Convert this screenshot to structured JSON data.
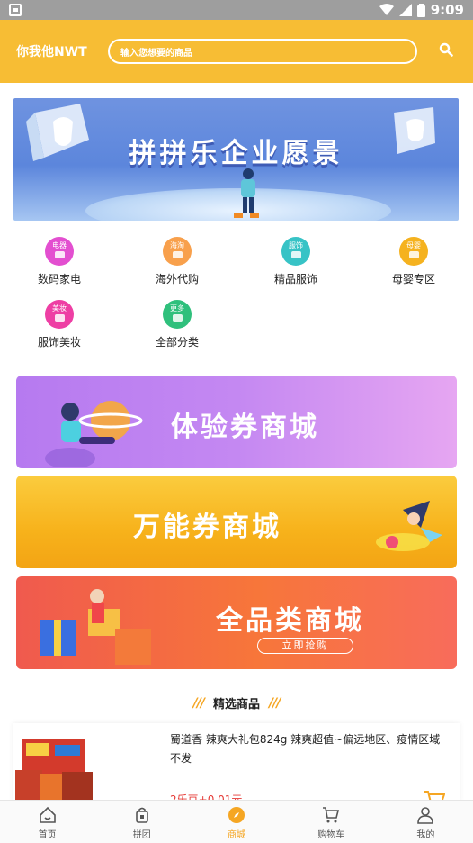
{
  "status_bar": {
    "time": "9:09"
  },
  "header": {
    "brand": "你我他NWT",
    "search_placeholder": "输入您想要的商品"
  },
  "banner": {
    "title": "拼拼乐企业愿景"
  },
  "categories": [
    {
      "icon_text": "电器",
      "label": "数码家电",
      "color": "#e34fd0"
    },
    {
      "icon_text": "海淘",
      "label": "海外代购",
      "color": "#f8a04c"
    },
    {
      "icon_text": "服饰",
      "label": "精品服饰",
      "color": "#37c3c6"
    },
    {
      "icon_text": "母婴",
      "label": "母婴专区",
      "color": "#f5b21f"
    },
    {
      "icon_text": "美妆",
      "label": "服饰美妆",
      "color": "#ee3fa4"
    },
    {
      "icon_text": "更多",
      "label": "全部分类",
      "color": "#2fc07c"
    }
  ],
  "promos": [
    {
      "title": "体验券商城"
    },
    {
      "title": "万能券商城"
    },
    {
      "title": "全品类商城",
      "cta": "立即抢购"
    }
  ],
  "section": {
    "slash": "///",
    "title": "精选商品"
  },
  "product": {
    "name": "蜀道香 辣爽大礼包824g 辣爽超值~偏远地区、疫情区域不发",
    "price": "2乐豆+0.01元"
  },
  "tabbar": [
    {
      "label": "首页",
      "icon": "home-icon"
    },
    {
      "label": "拼团",
      "icon": "bag-icon"
    },
    {
      "label": "商城",
      "icon": "compass-icon",
      "active": true
    },
    {
      "label": "购物车",
      "icon": "cart-icon"
    },
    {
      "label": "我的",
      "icon": "user-icon"
    }
  ],
  "colors": {
    "accent": "#f7bd34",
    "active_tab": "#f5a623",
    "price": "#e53935"
  }
}
